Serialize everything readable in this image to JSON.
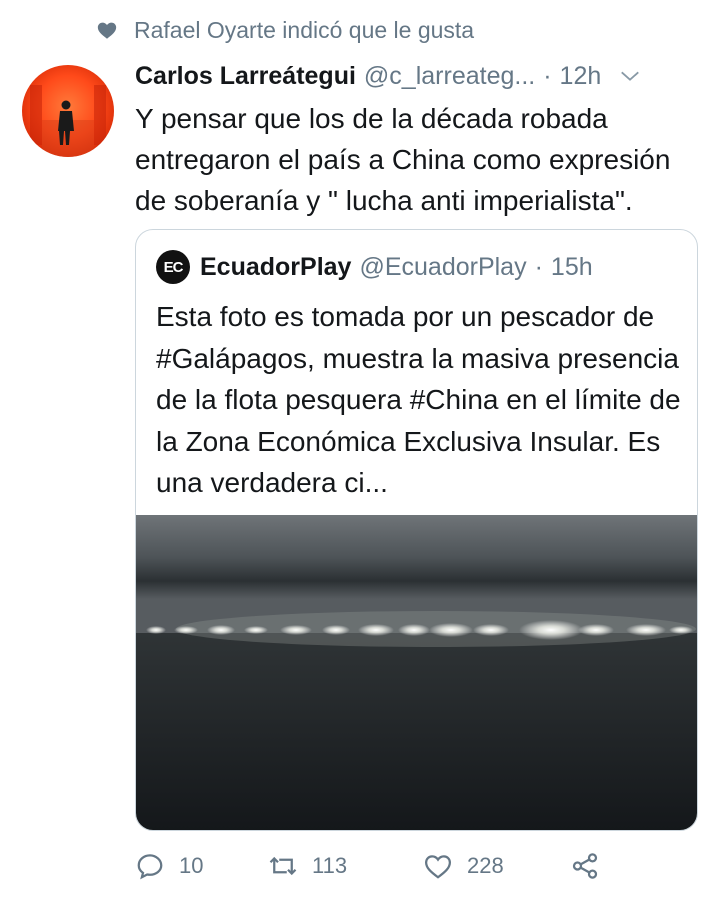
{
  "social_context": {
    "text": "Rafael Oyarte indicó que le gusta",
    "icon": "heart-icon"
  },
  "tweet": {
    "author_name": "Carlos Larreátegui",
    "author_handle": "@c_larreateg...",
    "separator": "·",
    "time": "12h",
    "text": "Y pensar que los de la década robada entregaron el país a China como expresión de soberanía y \" lucha anti imperialista\"."
  },
  "quoted_tweet": {
    "avatar_text": "EC",
    "author_name": "EcuadorPlay",
    "author_handle": "@EcuadorPlay",
    "separator": "·",
    "time": "15h",
    "text": "Esta foto es tomada por un pescador de #Galápagos, muestra la masiva presencia de la flota pesquera #China en el límite de la Zona Económica Exclusiva Insular. Es una verdadera ci..."
  },
  "actions": {
    "replies": "10",
    "retweets": "113",
    "likes": "228"
  },
  "colors": {
    "text_primary": "#14171a",
    "text_secondary": "#657786",
    "border": "#ccd6dd"
  }
}
